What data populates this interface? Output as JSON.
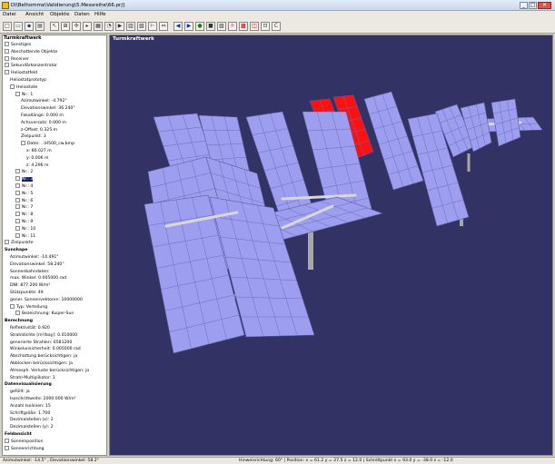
{
  "window": {
    "title": "DI\\Belhomme\\Validierung\\5.Messreihe\\66.prj]",
    "controls": [
      "_",
      "□",
      "✕"
    ]
  },
  "menu": [
    "Datei",
    "Ansicht",
    "Objekte",
    "Daten",
    "Hilfe"
  ],
  "toolbar": [
    {
      "name": "new-icon",
      "glyph": "□",
      "kind": ""
    },
    {
      "name": "open-icon",
      "glyph": "▭",
      "kind": ""
    },
    {
      "name": "save-icon",
      "glyph": "▪",
      "kind": "blu"
    },
    {
      "name": "tool-icon",
      "glyph": "▤",
      "kind": ""
    },
    {
      "name": "pointer-icon",
      "glyph": "↖",
      "kind": ""
    },
    {
      "name": "tree-icon",
      "glyph": "⊞",
      "kind": ""
    },
    {
      "name": "move-icon",
      "glyph": "✣",
      "kind": ""
    },
    {
      "name": "arrow-icon",
      "glyph": "▸",
      "kind": ""
    },
    {
      "name": "grid-icon",
      "glyph": "▦",
      "kind": ""
    },
    {
      "name": "clock-icon",
      "glyph": "◔",
      "kind": ""
    },
    {
      "name": "run-icon",
      "glyph": "▶",
      "kind": ""
    },
    {
      "name": "table-icon",
      "glyph": "▥",
      "kind": ""
    },
    {
      "name": "chart-icon",
      "glyph": "▧",
      "kind": ""
    },
    {
      "name": "measure-icon",
      "glyph": "⊢",
      "kind": ""
    },
    {
      "name": "link-icon",
      "glyph": "⇔",
      "kind": ""
    },
    {
      "name": "prev-icon",
      "glyph": "◀",
      "kind": "blu"
    },
    {
      "name": "next-icon",
      "glyph": "▶",
      "kind": "blu"
    },
    {
      "name": "go-icon",
      "glyph": "●",
      "kind": "grn"
    },
    {
      "name": "stop-icon",
      "glyph": "■",
      "kind": ""
    },
    {
      "name": "image-icon",
      "glyph": "▨",
      "kind": ""
    },
    {
      "name": "sun-icon",
      "glyph": "☼",
      "kind": "red"
    },
    {
      "name": "field-icon",
      "glyph": "▩",
      "kind": "red"
    },
    {
      "name": "view-icon",
      "glyph": "◫",
      "kind": "red"
    },
    {
      "name": "export-icon",
      "glyph": "⊡",
      "kind": ""
    },
    {
      "name": "refresh-icon",
      "glyph": "C",
      "kind": ""
    }
  ],
  "tree_title": "Turmkraftwerk",
  "tree": [
    {
      "t": "Sonstiges",
      "d": 0,
      "e": "+"
    },
    {
      "t": "Abschattende Objekte",
      "d": 0,
      "e": "+"
    },
    {
      "t": "Receiver",
      "d": 0,
      "e": "+"
    },
    {
      "t": "Sekundärkonzentrator",
      "d": 0,
      "e": "+"
    },
    {
      "t": "Heliostatfeld",
      "d": 0,
      "e": "-"
    },
    {
      "t": "Heliostatprototyp",
      "d": 1,
      "e": ""
    },
    {
      "t": "Heliostate",
      "d": 1,
      "e": "-"
    },
    {
      "t": "Nr.: 1",
      "d": 2,
      "e": "-"
    },
    {
      "t": "Azimutwinkel: -4.792°",
      "d": 3,
      "e": ""
    },
    {
      "t": "Elevationswinkel: 36.240°",
      "d": 3,
      "e": ""
    },
    {
      "t": "Fokallänge: 0.000 m",
      "d": 3,
      "e": ""
    },
    {
      "t": "Achsversatz: 0.000 m",
      "d": 3,
      "e": ""
    },
    {
      "t": "z-Offset: 0.325 m",
      "d": 3,
      "e": ""
    },
    {
      "t": "Zielpunkt: 3",
      "d": 3,
      "e": ""
    },
    {
      "t": "Datei: ..\\H500_cw.bmp",
      "d": 3,
      "e": "-"
    },
    {
      "t": "x: 80.027 m",
      "d": 4,
      "e": ""
    },
    {
      "t": "y: 0.006 m",
      "d": 4,
      "e": ""
    },
    {
      "t": "z: 4.296 m",
      "d": 4,
      "e": ""
    },
    {
      "t": "Nr.: 2",
      "d": 2,
      "e": "+"
    },
    {
      "t": "Nr.: 3",
      "d": 2,
      "e": "+",
      "sel": true
    },
    {
      "t": "Nr.: 4",
      "d": 2,
      "e": "+"
    },
    {
      "t": "Nr.: 5",
      "d": 2,
      "e": "+"
    },
    {
      "t": "Nr.: 6",
      "d": 2,
      "e": "+"
    },
    {
      "t": "Nr.: 7",
      "d": 2,
      "e": "+"
    },
    {
      "t": "Nr.: 8",
      "d": 2,
      "e": "+"
    },
    {
      "t": "Nr.: 9",
      "d": 2,
      "e": "+"
    },
    {
      "t": "Nr.: 10",
      "d": 2,
      "e": "+"
    },
    {
      "t": "Nr.: 11",
      "d": 2,
      "e": "+"
    },
    {
      "t": "Zielpunkte",
      "d": 0,
      "e": "+"
    },
    {
      "t": "Sunshape",
      "d": 0,
      "e": "",
      "b": true
    },
    {
      "t": "Azimutwinkel: -14.491°",
      "d": 1,
      "e": ""
    },
    {
      "t": "Elevationswinkel: 58.240°",
      "d": 1,
      "e": ""
    },
    {
      "t": "Sonnenbahndaten:",
      "d": 1,
      "e": ""
    },
    {
      "t": "max. Winkel: 0.005000 rad",
      "d": 1,
      "e": ""
    },
    {
      "t": "DNI: 877.200 W/m²",
      "d": 1,
      "e": ""
    },
    {
      "t": "Stützpunkte: 49",
      "d": 1,
      "e": ""
    },
    {
      "t": "gener. Sonnenvektoren: 10000000",
      "d": 1,
      "e": ""
    },
    {
      "t": "Typ: Verteilung",
      "d": 1,
      "e": "-"
    },
    {
      "t": "Bezeichnung: Kuiper-Sun",
      "d": 2,
      "e": "+"
    },
    {
      "t": "Berechnung",
      "d": 0,
      "e": "",
      "b": true
    },
    {
      "t": "Reflektivität: 0.920",
      "d": 1,
      "e": ""
    },
    {
      "t": "Strahldichte [m²/bay]: 0.010000",
      "d": 1,
      "e": ""
    },
    {
      "t": "generierte Strahlen: 6581200",
      "d": 1,
      "e": ""
    },
    {
      "t": "Winkelunsicherheit: 0.005000 rad",
      "d": 1,
      "e": ""
    },
    {
      "t": "Abschattung berücksichtigen: ja",
      "d": 1,
      "e": ""
    },
    {
      "t": "Abblocken berücksichtigen: ja",
      "d": 1,
      "e": ""
    },
    {
      "t": "Atmosph. Verluste berücksichtigen: ja",
      "d": 1,
      "e": ""
    },
    {
      "t": "Strahl-Multiplikator: 1",
      "d": 1,
      "e": ""
    },
    {
      "t": "Datenvisualisierung",
      "d": 0,
      "e": "",
      "b": true
    },
    {
      "t": "gefüllt: ja",
      "d": 1,
      "e": ""
    },
    {
      "t": "Isoschrittweite: 2000.000 W/m²",
      "d": 1,
      "e": ""
    },
    {
      "t": "Anzahl Isolinien: 15",
      "d": 1,
      "e": ""
    },
    {
      "t": "Schriftgröße: 1.700",
      "d": 1,
      "e": ""
    },
    {
      "t": "Dezimalstellen (x): 2",
      "d": 1,
      "e": ""
    },
    {
      "t": "Dezimalstellen (y): 2",
      "d": 1,
      "e": ""
    },
    {
      "t": "Feldansicht",
      "d": 0,
      "e": "",
      "b": true
    },
    {
      "t": "Sonnenposition",
      "d": 0,
      "e": "+"
    },
    {
      "t": "Sonnenrichtung",
      "d": 0,
      "e": "+"
    }
  ],
  "view_title": "Turmkraftwerk",
  "status": {
    "left": "Azimutwinkel: -14.5° , Elevationswinkel: 58.2°",
    "right": "Hinweisrichtung: 60° | Position: x = 61.2 y = 27.5 z = 12.0 | Schnittpunkt x = 93.0 y = -38.0 z = -12.0"
  },
  "colors": {
    "panel": "#9e9ef0",
    "highlight": "#ff1010",
    "background": "#323264"
  }
}
